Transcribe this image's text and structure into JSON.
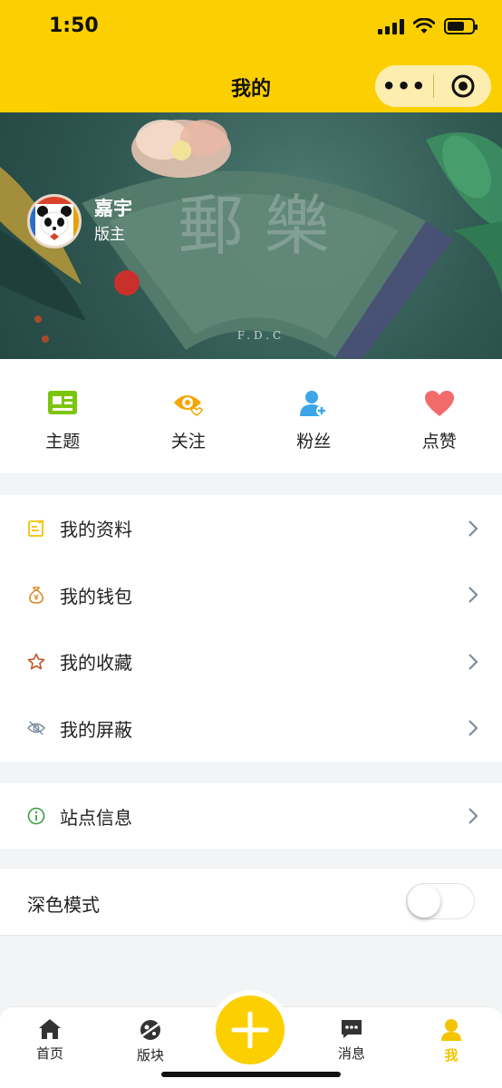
{
  "status_bar": {
    "time": "1:50"
  },
  "header": {
    "title": "我的",
    "more_label": "•••"
  },
  "banner": {
    "calligraphy": "郵 樂",
    "caption": "F.D.C"
  },
  "user": {
    "name": "嘉宇",
    "role": "版主"
  },
  "stats": [
    {
      "label": "主题",
      "icon": "topic-icon",
      "color": "#7cc50e"
    },
    {
      "label": "关注",
      "icon": "follow-eye-icon",
      "color": "#f5a600"
    },
    {
      "label": "粉丝",
      "icon": "fans-user-icon",
      "color": "#3ba5e8"
    },
    {
      "label": "点赞",
      "icon": "heart-icon",
      "color": "#f26b6b"
    }
  ],
  "menu": [
    {
      "label": "我的资料",
      "icon": "profile-edit-icon",
      "color": "#f2c300"
    },
    {
      "label": "我的钱包",
      "icon": "wallet-money-bag-icon",
      "color": "#e08a2a"
    },
    {
      "label": "我的收藏",
      "icon": "star-icon",
      "color": "#c0582a"
    },
    {
      "label": "我的屏蔽",
      "icon": "eye-hidden-icon",
      "color": "#7a8da0"
    }
  ],
  "site_info": {
    "label": "站点信息",
    "icon": "info-circle-icon",
    "color": "#3aa043"
  },
  "dark_mode": {
    "label": "深色模式",
    "enabled": false
  },
  "tabbar": {
    "items": [
      {
        "label": "首页",
        "icon": "home-icon"
      },
      {
        "label": "版块",
        "icon": "board-planet-icon"
      },
      {
        "label": "消息",
        "icon": "message-icon"
      },
      {
        "label": "我",
        "icon": "me-user-icon",
        "active": true
      }
    ],
    "fab_icon": "plus-icon"
  },
  "colors": {
    "accent": "#fcd000",
    "active_tab": "#f4c400"
  }
}
